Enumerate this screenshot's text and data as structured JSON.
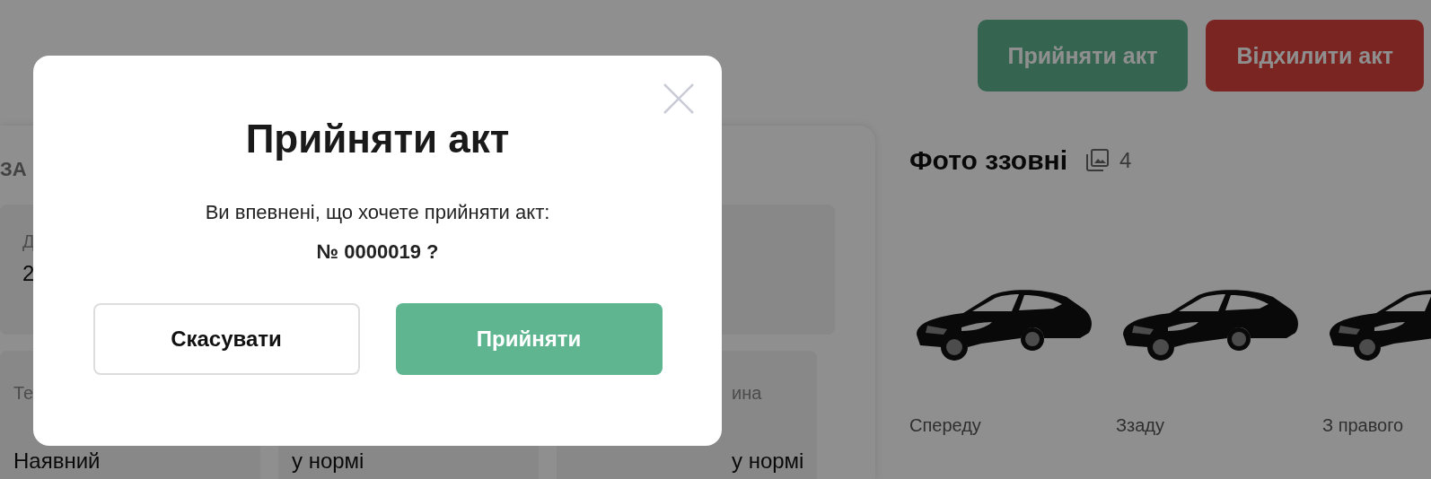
{
  "header_buttons": [
    {
      "label": "Прийняти акт",
      "kind": "accept"
    },
    {
      "label": "Відхилити акт",
      "kind": "reject"
    }
  ],
  "summary_card": {
    "heading": "ЗА",
    "tile_rows": [
      [
        {
          "label": "Д",
          "value": "2"
        },
        {}
      ],
      [
        {
          "label": "Те",
          "value": "Наявний"
        },
        {
          "value": "у нормі"
        },
        {
          "label": "ина",
          "value": "у нормі"
        }
      ]
    ]
  },
  "photos": {
    "title": "Фото ззовні",
    "count": "4",
    "items": [
      {
        "kind": "picture",
        "caption": "Спереду"
      },
      {
        "kind": "picture",
        "caption": "Ззаду"
      },
      {
        "kind": "picture",
        "caption": "З правого"
      }
    ]
  },
  "dialog": {
    "title": "Прийняти акт",
    "message": "Ви впевнені, що хочете прийняти акт:",
    "number": "№ 0000019 ?",
    "buttons": [
      {
        "label": "Скасувати",
        "kind": "cancel"
      },
      {
        "label": "Прийняти",
        "kind": "confirm"
      }
    ]
  }
}
